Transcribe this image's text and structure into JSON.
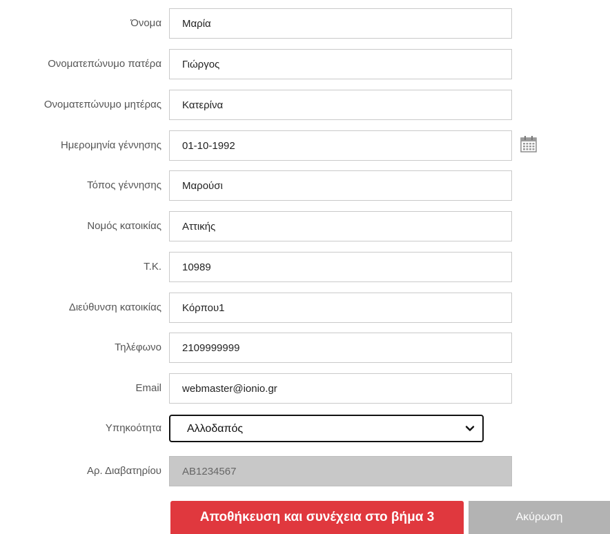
{
  "form": {
    "fields": [
      {
        "label": "Όνομα",
        "value": "Μαρία"
      },
      {
        "label": "Ονοματεπώνυμο πατέρα",
        "value": "Γιώργος"
      },
      {
        "label": "Ονοματεπώνυμο μητέρας",
        "value": "Κατερίνα"
      },
      {
        "label": "Ημερομηνία γέννησης",
        "value": "01-10-1992"
      },
      {
        "label": "Τόπος γέννησης",
        "value": "Μαρούσι"
      },
      {
        "label": "Νομός κατοικίας",
        "value": "Αττικής"
      },
      {
        "label": "Τ.Κ.",
        "value": "10989"
      },
      {
        "label": "Διεύθυνση κατοικίας",
        "value": "Κόρπου1"
      },
      {
        "label": "Τηλέφωνο",
        "value": "2109999999"
      },
      {
        "label": "Email",
        "value": "webmaster@ionio.gr"
      }
    ],
    "citizenship": {
      "label": "Υπηκοότητα",
      "selected": "Αλλοδαπός"
    },
    "passport": {
      "label": "Αρ. Διαβατηρίου",
      "value": "AB1234567"
    }
  },
  "buttons": {
    "save_label": "Αποθήκευση και συνέχεια στο βήμα 3",
    "cancel_label": "Ακύρωση"
  },
  "icons": {
    "date_picker": "calendar-icon",
    "select_caret": "chevron-down-icon"
  },
  "colors": {
    "save_button": "#e0383e",
    "cancel_button": "#b3b3b3",
    "readonly_field": "#c8c8c8"
  }
}
